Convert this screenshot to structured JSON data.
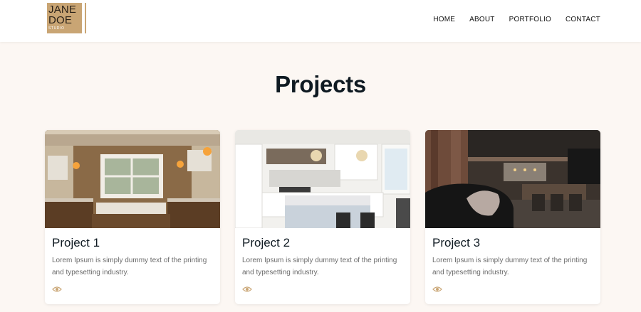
{
  "logo": {
    "line1": "JANE",
    "line2": "DOE",
    "line3": "STUDIO"
  },
  "nav": [
    "HOME",
    "ABOUT",
    "PORTFOLIO",
    "CONTACT"
  ],
  "section": {
    "title": "Projects"
  },
  "projects": [
    {
      "title": "Project 1",
      "desc": "Lorem Ipsum is simply dummy text of the printing and typesetting industry.",
      "icon": "eye-icon"
    },
    {
      "title": "Project 2",
      "desc": "Lorem Ipsum is simply dummy text of the printing and typesetting industry.",
      "icon": "eye-icon"
    },
    {
      "title": "Project 3",
      "desc": "Lorem Ipsum is simply dummy text of the printing and typesetting industry.",
      "icon": "eye-icon"
    }
  ],
  "colors": {
    "accent": "#c9a574",
    "background": "#fcf7f3"
  }
}
